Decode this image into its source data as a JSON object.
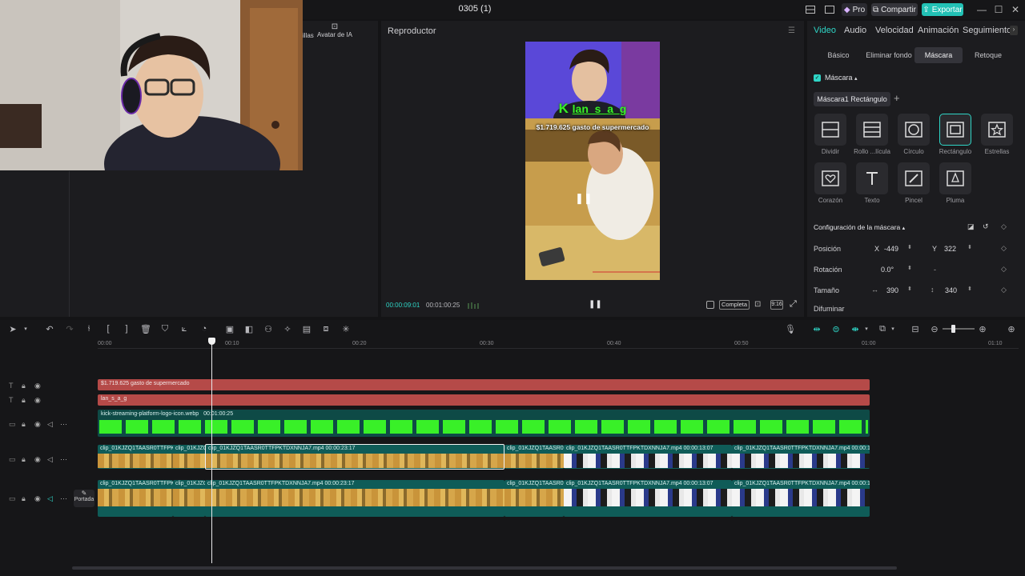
{
  "window": {
    "title": "0305 (1)",
    "pro_label": "Pro",
    "share_label": "Compartir",
    "export_label": "Exportar"
  },
  "media_panel": {
    "tab_partial": "illas",
    "avatar_label": "Avatar de IA"
  },
  "player": {
    "title": "Reproductor",
    "caption_name": "lan_s_a_g",
    "caption_money": "$1.719.625 gasto de supermercado",
    "time_current": "00:00:09:01",
    "time_total": "00:01:00:25",
    "view_mode": "Completa",
    "aspect": "9:16"
  },
  "props": {
    "tabs": [
      "Video",
      "Audio",
      "Velocidad",
      "Animación",
      "Seguimiento"
    ],
    "subtabs": [
      "Básico",
      "Eliminar fondo",
      "Máscara",
      "Retoque"
    ],
    "mask_section": "Máscara",
    "mask_current": "Máscara1 Rectángulo",
    "mask_tiles_row1": [
      "Dividir",
      "Rollo ...lícula",
      "Círculo",
      "Rectángulo",
      "Estrellas"
    ],
    "mask_tiles_row2": [
      "Corazón",
      "Texto",
      "Pincel",
      "Pluma"
    ],
    "config_title": "Configuración de la máscara",
    "position_label": "Posición",
    "pos_x_label": "X",
    "pos_x": "-449",
    "pos_y_label": "Y",
    "pos_y": "322",
    "rotation_label": "Rotación",
    "rotation": "0.0°",
    "rotation_dash": "-",
    "size_label": "Tamaño",
    "size_w": "390",
    "size_h": "340",
    "blur_label": "Difuminar"
  },
  "timeline": {
    "ruler": [
      "00:00",
      "00:10",
      "00:20",
      "00:30",
      "00:40",
      "00:50",
      "01:00",
      "01:10"
    ],
    "text_clip_1": "$1.719.625 gasto de supermercado",
    "text_clip_2": "lan_s_a_g",
    "sticker_clip": "kick-streaming-platform-logo-icon.webp",
    "sticker_duration": "00:01:00:25",
    "video_clips": [
      {
        "label": "clip_01KJZQ1TAASR0TTFPKT"
      },
      {
        "label": "clip_01KJZQ"
      },
      {
        "label": "clip_01KJZQ1TAASR0TTFPKTDXNNJA7.mp4   00:00:23:17"
      },
      {
        "label": "clip_01KJZQ1TAASR0TTF"
      },
      {
        "label": "clip_01KJZQ1TAASR0TTFPKTDXNNJA7.mp4   00:00:13:07"
      },
      {
        "label": "clip_01KJZQ1TAASR0TTFPKTDXNNJA7.mp4   00:00:10:2"
      }
    ],
    "audio_clips": [
      {
        "label": "clip_01KJZQ1TAASR0TTFPKTDXNN"
      },
      {
        "label": "clip_01KJZQ"
      },
      {
        "label": "clip_01KJZQ1TAASR0TTFPKTDXNNJA7.mp4   00:00:23:17"
      },
      {
        "label": "clip_01KJZQ1TAASR0TTF"
      },
      {
        "label": "clip_01KJZQ1TAASR0TTFPKTDXNNJA7.mp4   00:00:13:07"
      },
      {
        "label": "clip_01KJZQ1TAASR0TTFPKTDXNNJA7.mp4   00:00:10:2"
      }
    ],
    "cover_label": "Portada"
  },
  "colors": {
    "accent": "#2fd5c6",
    "text_clip": "#b54a48",
    "sticker_green": "#39f028",
    "video_track": "#0f5c58"
  }
}
